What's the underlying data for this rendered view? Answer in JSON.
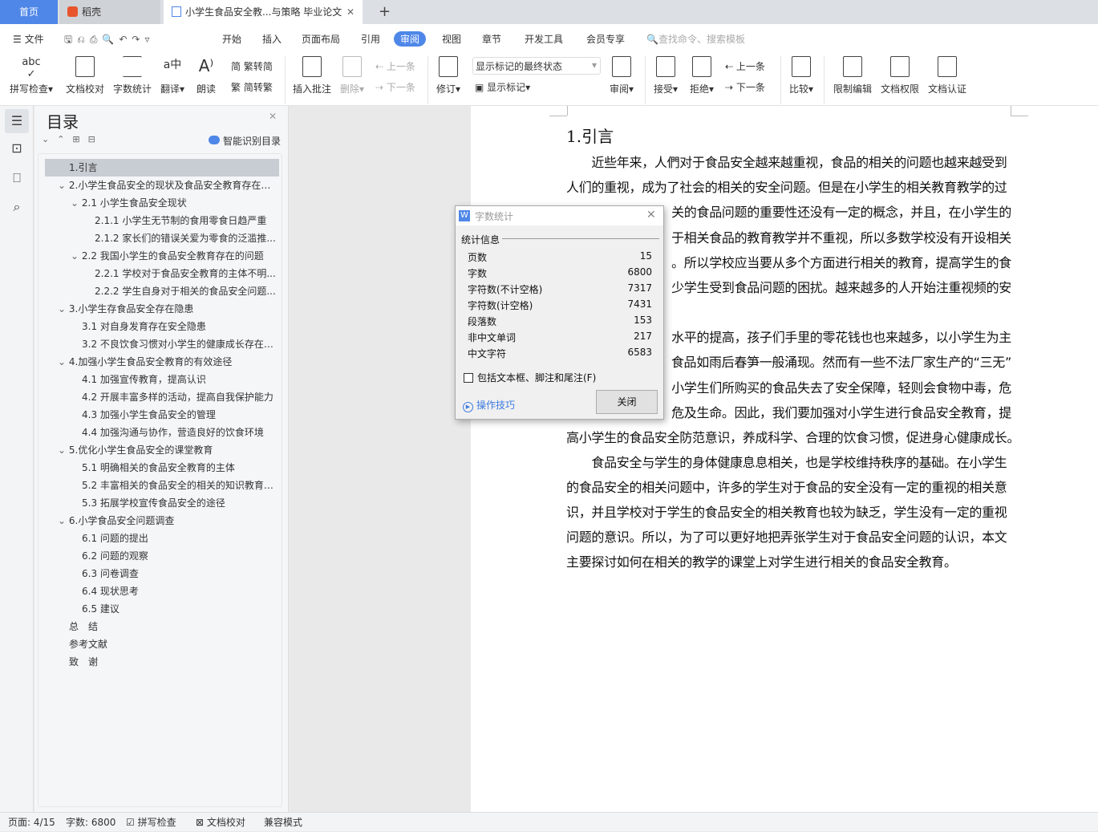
{
  "tabs": {
    "home": "首页",
    "daoke": "稻壳",
    "document": "小学生食品安全教...与策略 毕业论文"
  },
  "menu": {
    "file": "文件",
    "items": [
      "开始",
      "插入",
      "页面布局",
      "引用",
      "审阅",
      "视图",
      "章节",
      "开发工具",
      "会员专享"
    ],
    "active": "审阅",
    "search_placeholder": "查找命令、搜索模板"
  },
  "ribbon": {
    "spell": "拼写检查",
    "proof": "文档校对",
    "wordcount": "字数统计",
    "translate": "翻译",
    "read": "朗读",
    "t2s": "繁转简",
    "s2t": "简转繁",
    "insert_comment": "插入批注",
    "delete": "删除",
    "prev": "上一条",
    "next": "下一条",
    "revise": "修订",
    "markup_state": "显示标记的最终状态",
    "show_markup": "显示标记",
    "review": "审阅",
    "accept": "接受",
    "reject": "拒绝",
    "prev2": "上一条",
    "next2": "下一条",
    "compare": "比较",
    "restrict": "限制编辑",
    "permission": "文档权限",
    "certify": "文档认证"
  },
  "nav": {
    "title": "目录",
    "smart": "智能识别目录",
    "items": [
      {
        "t": "1.引言",
        "lvl": 0,
        "sel": true
      },
      {
        "t": "2.小学生食品安全的现状及食品安全教育存在的...",
        "lvl": 0,
        "exp": true
      },
      {
        "t": "2.1 小学生食品安全现状",
        "lvl": 1,
        "exp": true
      },
      {
        "t": "2.1.1 小学生无节制的食用零食日趋严重",
        "lvl": 2
      },
      {
        "t": "2.1.2 家长们的错误关爱为零食的泛滥推...",
        "lvl": 2
      },
      {
        "t": "2.2 我国小学生的食品安全教育存在的问题",
        "lvl": 1,
        "exp": true
      },
      {
        "t": "2.2.1 学校对于食品安全教育的主体不明...",
        "lvl": 2
      },
      {
        "t": "2.2.2 学生自身对于相关的食品安全问题...",
        "lvl": 2
      },
      {
        "t": "3.小学生存食品安全存在隐患",
        "lvl": 0,
        "exp": true
      },
      {
        "t": "3.1 对自身发育存在安全隐患",
        "lvl": 1
      },
      {
        "t": "3.2 不良饮食习惯对小学生的健康成长存在安...",
        "lvl": 1
      },
      {
        "t": "4.加强小学生食品安全教育的有效途径",
        "lvl": 0,
        "exp": true
      },
      {
        "t": "4.1 加强宣传教育，提高认识",
        "lvl": 1
      },
      {
        "t": "4.2 开展丰富多样的活动，提高自我保护能力",
        "lvl": 1
      },
      {
        "t": "4.3 加强小学生食品安全的管理",
        "lvl": 1
      },
      {
        "t": "4.4 加强沟通与协作，营造良好的饮食环境",
        "lvl": 1
      },
      {
        "t": "5.优化小学生食品安全的课堂教育",
        "lvl": 0,
        "exp": true
      },
      {
        "t": "5.1 明确相关的食品安全教育的主体",
        "lvl": 1
      },
      {
        "t": "5.2 丰富相关的食品安全的相关的知识教育形...",
        "lvl": 1
      },
      {
        "t": "5.3 拓展学校宣传食品安全的途径",
        "lvl": 1
      },
      {
        "t": "6.小学食品安全问题调查",
        "lvl": 0,
        "exp": true
      },
      {
        "t": "6.1 问题的提出",
        "lvl": 1
      },
      {
        "t": "6.2 问题的观察",
        "lvl": 1
      },
      {
        "t": "6.3 问卷调查",
        "lvl": 1
      },
      {
        "t": "6.4 现状思考",
        "lvl": 1
      },
      {
        "t": "6.5 建议",
        "lvl": 1
      },
      {
        "t": "总　结",
        "lvl": 0
      },
      {
        "t": "参考文献",
        "lvl": 0
      },
      {
        "t": "致　谢",
        "lvl": 0
      }
    ]
  },
  "doc": {
    "heading": "1.引言",
    "lines": [
      "　　近些年来，人們对于食品安全越来越重视，食品的相关的问题也越来越受到",
      "人们的重视，成为了社会的相关的安全问题。但是在小学生的相关教育教学的过",
      "关的食品问题的重要性还没有一定的概念，并且，在小学生的",
      "于相关食品的教育教学并不重视，所以多数学校没有开设相关",
      "。所以学校应当要从多个方面进行相关的教育，提高学生的食",
      "少学生受到食品问题的困扰。越来越多的人开始注重视频的安",
      "",
      "水平的提高，孩子们手里的零花钱也也来越多，以小学生为主",
      "食品如雨后春笋一般涌现。然而有一些不法厂家生产的“三无”",
      "小学生们所购买的食品失去了安全保障，轻则会食物中毒，危",
      "危及生命。因此，我们要加强对小学生进行食品安全教育，提",
      "高小学生的食品安全防范意识，养成科学、合理的饮食习惯，促进身心健康成长。",
      "　　食品安全与学生的身体健康息息相关，也是学校维持秩序的基础。在小学生",
      "的食品安全的相关问题中，许多的学生对于食品的安全没有一定的重视的相关意",
      "识，并且学校对于学生的食品安全的相关教育也较为缺乏，学生没有一定的重视",
      "问题的意识。所以，为了可以更好地把弄张学生对于食品安全问题的认识，本文",
      "主要探讨如何在相关的教学的课堂上对学生进行相关的食品安全教育。"
    ]
  },
  "dialog": {
    "title": "字数统计",
    "group": "统计信息",
    "stats": [
      {
        "k": "页数",
        "v": "15"
      },
      {
        "k": "字数",
        "v": "6800"
      },
      {
        "k": "字符数(不计空格)",
        "v": "7317"
      },
      {
        "k": "字符数(计空格)",
        "v": "7431"
      },
      {
        "k": "段落数",
        "v": "153"
      },
      {
        "k": "非中文单词",
        "v": "217"
      },
      {
        "k": "中文字符",
        "v": "6583"
      }
    ],
    "checkbox": "包括文本框、脚注和尾注(F)",
    "checked": false,
    "tips": "操作技巧",
    "close": "关闭"
  },
  "status": {
    "page": "页面: 4/15",
    "words": "字数: 6800",
    "spell": "拼写检查",
    "proof": "文档校对",
    "compat": "兼容模式"
  },
  "colors": {
    "accent": "#4f87e8",
    "link": "#3c7be0"
  }
}
